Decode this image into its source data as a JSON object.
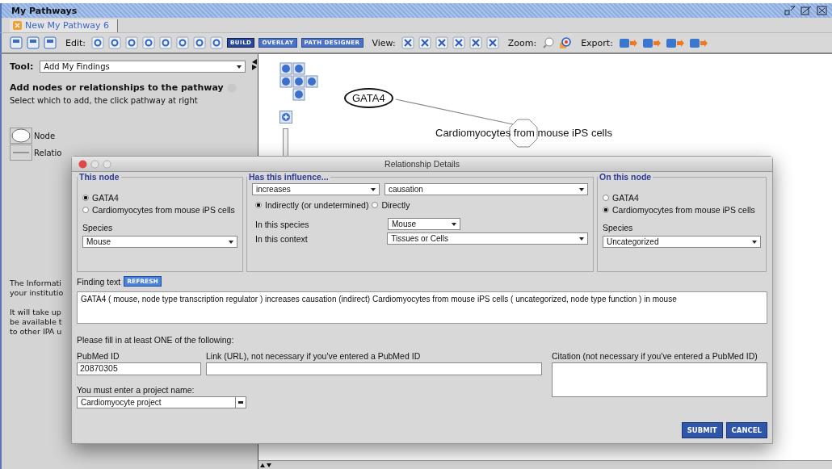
{
  "window": {
    "title": "My Pathways"
  },
  "tabs": [
    {
      "label": "New My Pathway 6",
      "selected": true
    }
  ],
  "toolbar": {
    "edit_label": "Edit:",
    "modes": [
      {
        "label": "BUILD",
        "selected": true
      },
      {
        "label": "OVERLAY",
        "selected": false
      },
      {
        "label": "PATH DESIGNER",
        "selected": false
      }
    ],
    "view_label": "View:",
    "zoom_label": "Zoom:",
    "export_label": "Export:"
  },
  "left_panel": {
    "tool_label": "Tool:",
    "tool_value": "Add My Findings",
    "heading": "Add nodes or relationships to the pathway",
    "subheading": "Select which to add, the click pathway at right",
    "palette": [
      {
        "kind": "node",
        "label": "Node"
      },
      {
        "kind": "relationship",
        "label": "Relatio"
      }
    ],
    "info_lines": [
      "The Informati",
      "your institutio",
      "It will take up",
      "be available t",
      "to other IPA u"
    ]
  },
  "canvas": {
    "nodes": [
      {
        "kind": "ellipse",
        "label": "GATA4"
      },
      {
        "kind": "octagon",
        "label": "Cardiomyocytes from mouse iPS cells"
      }
    ]
  },
  "dialog": {
    "title": "Relationship Details",
    "this_node": {
      "title": "This node",
      "options": [
        {
          "label": "GATA4",
          "selected": true
        },
        {
          "label": "Cardiomyocytes from mouse iPS cells",
          "selected": false
        }
      ],
      "species_label": "Species",
      "species": "Mouse"
    },
    "influence": {
      "title": "Has this influence...",
      "effect": "increases",
      "type": "causation",
      "modes": [
        {
          "label": "Indirectly (or undetermined)",
          "selected": true
        },
        {
          "label": "Directly",
          "selected": false
        }
      ],
      "species_label": "In this species",
      "species": "Mouse",
      "context_label": "In this context",
      "context": "Tissues or Cells"
    },
    "on_node": {
      "title": "On this node",
      "options": [
        {
          "label": "GATA4",
          "selected": false
        },
        {
          "label": "Cardiomyocytes from mouse iPS cells",
          "selected": true
        }
      ],
      "species_label": "Species",
      "species": "Uncategorized"
    },
    "finding_label": "Finding text",
    "refresh": "REFRESH",
    "finding_text": "GATA4 ( mouse,  node type transcription regulator ) increases causation (indirect) Cardiomyocytes from mouse iPS cells ( uncategorized, node type function ) in mouse",
    "fill_hint": "Please fill in at least ONE of the following:",
    "pubmed_label": "PubMed ID",
    "pubmed": "20870305",
    "link_label": "Link (URL), not necessary if you've entered a PubMed ID",
    "citation_label": "Citation (not necessary if you've entered a PubMed ID)",
    "project_label": "You must enter a project name:",
    "project": "Cardiomyocyte project",
    "buttons": [
      "SUBMIT",
      "CANCEL"
    ]
  }
}
